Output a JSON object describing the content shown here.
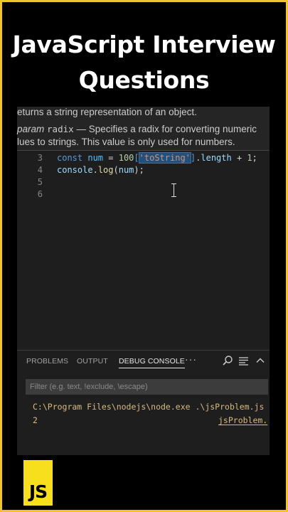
{
  "title": {
    "line1": "JavaScript Interview",
    "line2": "Questions"
  },
  "hover_doc": {
    "line1": "eturns a string representation of an object.",
    "param_tag": "param",
    "param_name": "radix",
    "param_desc": "— Specifies a radix for converting numeric",
    "line3": "lues to strings. This value is only used for numbers."
  },
  "code": {
    "lines": [
      {
        "number": "3"
      },
      {
        "number": "4"
      },
      {
        "number": "5"
      },
      {
        "number": "6"
      }
    ],
    "line3": {
      "kw": "const",
      "var": "num",
      "eq": " = ",
      "num1": "100",
      "open": "[",
      "str": "'toString'",
      "close": "]",
      "dot": ".",
      "prop": "length",
      "plus": " + ",
      "num2": "1",
      "semi": ";"
    },
    "line4": {
      "obj": "console",
      "dot": ".",
      "fn": "log",
      "open": "(",
      "arg": "num",
      "close": ");"
    }
  },
  "panel": {
    "tabs": [
      "PROBLEMS",
      "OUTPUT",
      "DEBUG CONSOLE"
    ],
    "more": "···",
    "filter_placeholder": "Filter (e.g. text, !exclude, \\escape)",
    "output_line1": "C:\\Program Files\\nodejs\\node.exe .\\jsProblem.js",
    "output_value": "2",
    "output_source": "jsProblem."
  },
  "logo": {
    "text": "JS"
  },
  "icons": [
    "search-icon",
    "filter-lines-icon",
    "chevron-up-icon",
    "text-cursor-icon"
  ],
  "colors": {
    "border": "#f2c230",
    "editor_bg": "#1e1e1e",
    "keyword": "#569cd6",
    "string": "#ce9178",
    "number": "#b5cea8",
    "output_text": "#d7ba7d",
    "js_yellow": "#f7df1e"
  }
}
